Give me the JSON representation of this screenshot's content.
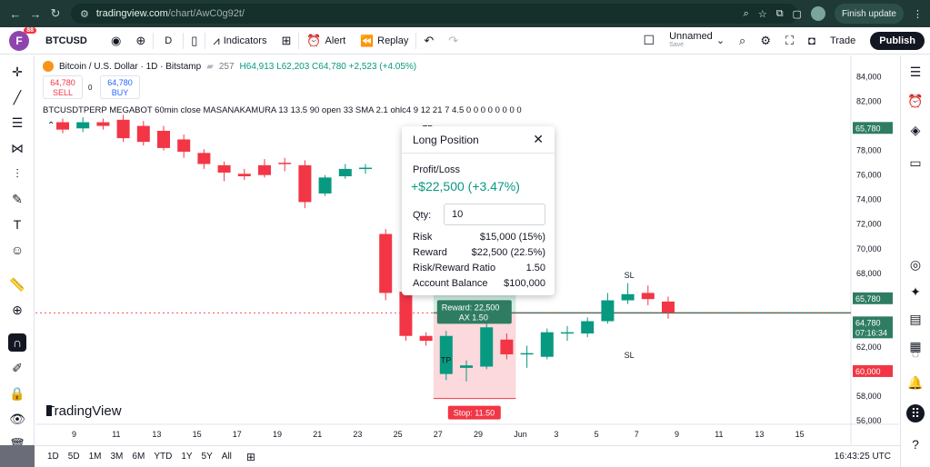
{
  "browser": {
    "url_host": "tradingview.com",
    "url_path": "/chart/AwC0g92t/",
    "finish_update": "Finish update"
  },
  "toolbar": {
    "avatar_letter": "F",
    "avatar_badge": "88",
    "symbol": "BTCUSD",
    "interval": "D",
    "indicators": "Indicators",
    "alert": "Alert",
    "replay": "Replay",
    "layout_name": "Unnamed",
    "layout_sub": "Save",
    "trade": "Trade",
    "publish": "Publish"
  },
  "legend": {
    "title": "Bitcoin / U.S. Dollar · 1D · Bitstamp",
    "volume": "257",
    "ohlc": "H64,913  L62,203  C64,780  +2,523 (+4.05%)",
    "sell_price": "64,780",
    "sell_label": "SELL",
    "spread": "0",
    "buy_price": "64,780",
    "buy_label": "BUY",
    "indicator": "BTCUSDTPERP MEGABOT 60min close MASANAKAMURA 13 13.5 90 open 33 SMA 2.1 ohlc4 9 12 21 7 4.5  0  0 0 0 0 0 0 0"
  },
  "position_panel": {
    "title": "Long Position",
    "pl_label": "Profit/Loss",
    "pl_value": "+$22,500 (+3.47%)",
    "qty_label": "Qty:",
    "qty_value": "10",
    "rows": [
      {
        "label": "Risk",
        "value": "$15,000 (15%)"
      },
      {
        "label": "Reward",
        "value": "$22,500 (22.5%)"
      },
      {
        "label": "Risk/Reward Ratio",
        "value": "1.50"
      },
      {
        "label": "Account Balance",
        "value": "$100,000"
      }
    ]
  },
  "chart_labels": {
    "tp_top": "TP",
    "tp_bottom": "TP",
    "sl_top": "SL",
    "sl_bottom": "SL",
    "reward_line1": "Reward: 22,500",
    "reward_line2": "AX 1.50",
    "stop_label": "Stop: 11.50",
    "watermark": "TradingView"
  },
  "price_axis": {
    "ticks": [
      "84,000",
      "82,000",
      "80,000",
      "78,000",
      "76,000",
      "74,000",
      "72,000",
      "70,000",
      "68,000",
      "66,000",
      "64,000",
      "62,000",
      "60,000",
      "58,000",
      "56,000"
    ],
    "tag_target": "65,780",
    "tag_entry": "65,780",
    "tag_last": "64,780",
    "tag_countdown": "07:16:34",
    "tag_stop": "60,000"
  },
  "time_axis": {
    "labels": [
      "9",
      "11",
      "13",
      "15",
      "17",
      "19",
      "21",
      "23",
      "25",
      "27",
      "29",
      "Jun",
      "3",
      "5",
      "7",
      "9",
      "11",
      "13",
      "15"
    ]
  },
  "bottom_bar": {
    "timeframes": [
      "1D",
      "5D",
      "1M",
      "3M",
      "6M",
      "YTD",
      "1Y",
      "5Y",
      "All"
    ],
    "clock": "16:43:25 UTC"
  },
  "colors": {
    "up": "#089981",
    "down": "#f23645",
    "profit_zone": "#d2eee3",
    "loss_zone": "#fbd9dc"
  },
  "chart_data": {
    "type": "candlestick",
    "ylim": [
      56000,
      85000
    ],
    "x_labels": [
      "9",
      "11",
      "13",
      "15",
      "17",
      "19",
      "21",
      "23",
      "25",
      "27",
      "29",
      "Jun",
      "3",
      "5",
      "7",
      "9",
      "11",
      "13",
      "15"
    ],
    "candles": [
      {
        "o": 80300,
        "c": 79700,
        "h": 80600,
        "l": 79400
      },
      {
        "o": 79800,
        "c": 80300,
        "h": 80700,
        "l": 79500
      },
      {
        "o": 80300,
        "c": 80000,
        "h": 80600,
        "l": 79700
      },
      {
        "o": 80500,
        "c": 79000,
        "h": 80900,
        "l": 78700
      },
      {
        "o": 80000,
        "c": 78700,
        "h": 80400,
        "l": 78400
      },
      {
        "o": 79600,
        "c": 78200,
        "h": 80000,
        "l": 78000
      },
      {
        "o": 78900,
        "c": 77900,
        "h": 79300,
        "l": 77400
      },
      {
        "o": 77800,
        "c": 76900,
        "h": 78100,
        "l": 76500
      },
      {
        "o": 76800,
        "c": 76200,
        "h": 77100,
        "l": 75500
      },
      {
        "o": 76100,
        "c": 75900,
        "h": 76500,
        "l": 75600
      },
      {
        "o": 76800,
        "c": 76000,
        "h": 77300,
        "l": 75800
      },
      {
        "o": 77000,
        "c": 76900,
        "h": 77400,
        "l": 76300
      },
      {
        "o": 76800,
        "c": 73800,
        "h": 77200,
        "l": 73300
      },
      {
        "o": 74500,
        "c": 75800,
        "h": 76000,
        "l": 74300
      },
      {
        "o": 75900,
        "c": 76500,
        "h": 76900,
        "l": 75700
      },
      {
        "o": 76500,
        "c": 76600,
        "h": 76900,
        "l": 76100
      },
      {
        "o": 71200,
        "c": 66400,
        "h": 71600,
        "l": 65800
      },
      {
        "o": 66500,
        "c": 62900,
        "h": 67000,
        "l": 62500
      },
      {
        "o": 62900,
        "c": 62500,
        "h": 63200,
        "l": 62100
      },
      {
        "o": 59800,
        "c": 62900,
        "h": 63300,
        "l": 59300
      },
      {
        "o": 60300,
        "c": 60500,
        "h": 60900,
        "l": 59200
      },
      {
        "o": 60400,
        "c": 63600,
        "h": 64100,
        "l": 60200
      },
      {
        "o": 62600,
        "c": 61400,
        "h": 63100,
        "l": 61000
      },
      {
        "o": 61400,
        "c": 61500,
        "h": 62100,
        "l": 60300
      },
      {
        "o": 61200,
        "c": 63200,
        "h": 63500,
        "l": 61000
      },
      {
        "o": 63100,
        "c": 63200,
        "h": 63700,
        "l": 62500
      },
      {
        "o": 63100,
        "c": 64100,
        "h": 64400,
        "l": 62800
      },
      {
        "o": 64100,
        "c": 65800,
        "h": 66400,
        "l": 63900
      },
      {
        "o": 65800,
        "c": 66300,
        "h": 67200,
        "l": 65500
      },
      {
        "o": 66400,
        "c": 65900,
        "h": 67000,
        "l": 65400
      },
      {
        "o": 65700,
        "c": 64800,
        "h": 66100,
        "l": 64300
      }
    ]
  }
}
